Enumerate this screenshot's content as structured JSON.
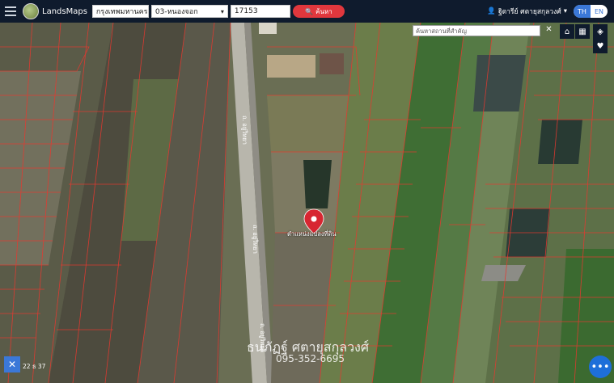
{
  "header": {
    "brand": "LandsMaps",
    "province": "กรุงเทพมหานคร",
    "district": "03-หนองจอก",
    "parcel_no": "17153",
    "search_label": "ค้นหา",
    "user_name": "ฐิตารีย์ ศตายุสกุลวงศ์",
    "lang_th": "TH",
    "lang_en": "EN"
  },
  "map": {
    "place_search_placeholder": "ค้นหาสถานที่สำคัญ",
    "road_label_1": "ถ. อยู่วิทยา",
    "road_label_2": "ถ. อยู่วิทยา",
    "road_label_3": "ถ. อยู่วิทยา",
    "pin_label": "ตำแหน่งแปลงที่ดิน",
    "watermark_name": "ธนภัฏฐ์ ศตายุสกุลวงศ์",
    "watermark_phone": "095-352-6695",
    "scale_text": "22 ธ 37",
    "parcel_line_color": "#e8382f",
    "marker_color": "#d72631"
  }
}
